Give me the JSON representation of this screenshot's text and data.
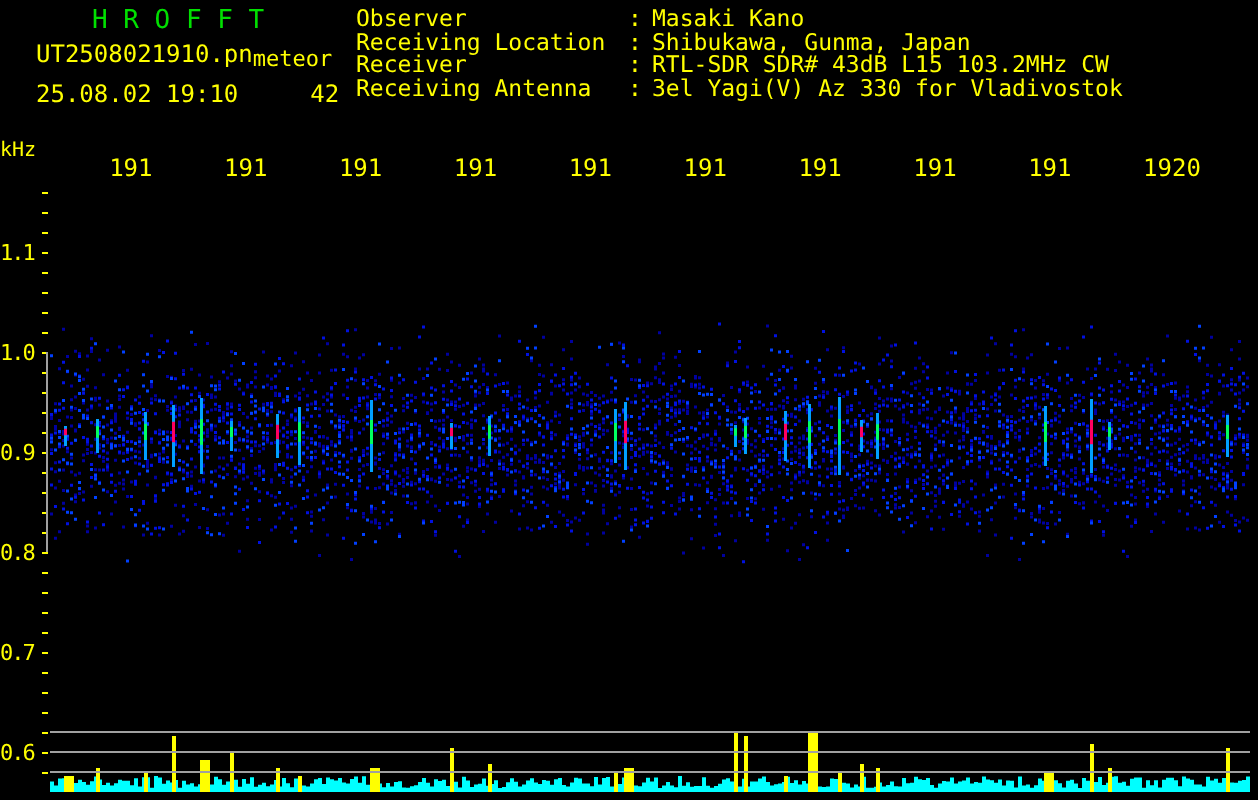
{
  "header": {
    "title": "H R O F F T",
    "filename": "UT2508021910.pn",
    "tag": "meteor",
    "timestamp": "25.08.02 19:10",
    "count": "42"
  },
  "info": [
    {
      "label": "Observer",
      "separator": ":",
      "value": "Masaki Kano"
    },
    {
      "label": "Receiving Location",
      "separator": ":",
      "value": "Shibukawa, Gunma, Japan"
    },
    {
      "label": "Receiver",
      "separator": ":",
      "value": "RTL-SDR SDR# 43dB L15 103.2MHz CW"
    },
    {
      "label": "Receiving Antenna",
      "separator": ":",
      "value": "3el Yagi(V) Az 330 for Vladivostok"
    }
  ],
  "frequency_axis": {
    "unit": "kHz",
    "labels": [
      "1.1",
      "1.0",
      "0.9",
      "0.8",
      "0.7",
      "0.6"
    ]
  },
  "time_axis": {
    "labels": [
      "191",
      "191",
      "191",
      "191",
      "191",
      "191",
      "191",
      "191",
      "191",
      "1920"
    ]
  }
}
